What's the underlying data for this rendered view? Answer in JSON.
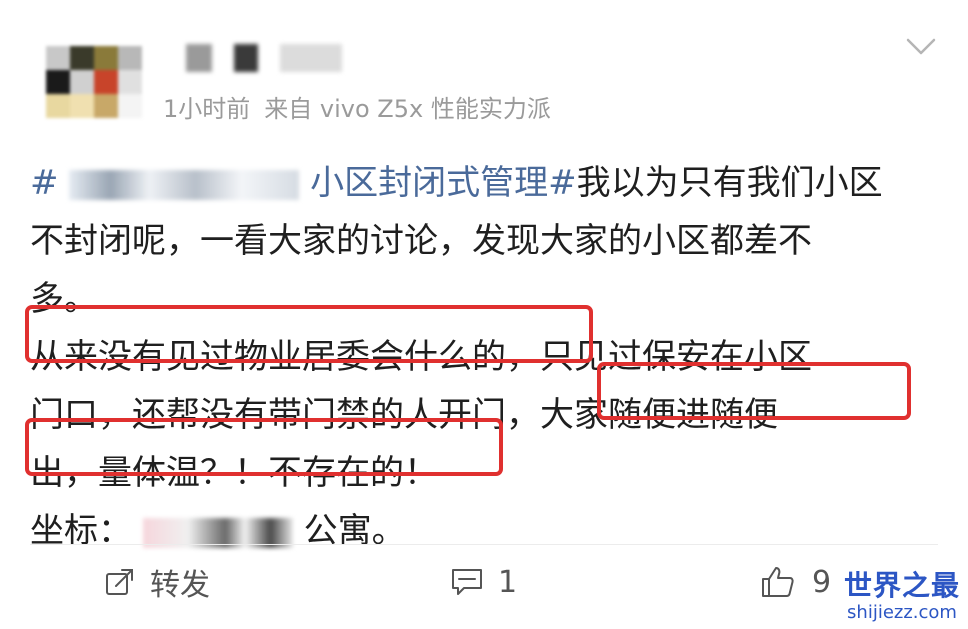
{
  "post": {
    "meta": {
      "time": "1小时前",
      "source": "来自 vivo Z5x 性能实力派"
    },
    "body": {
      "topic_hash_start": "#",
      "topic_text": "小区封闭式管理#",
      "line1_rest": "我以为只有我们小区",
      "line2": "不封闭呢，一看大家的讨论，发现大家的小区都差不",
      "line3": "多。",
      "line4_highlight": "从来没有见过物业居委会什么的，",
      "line4_rest": "只见过保安在小区",
      "line5_start": "门口，还帮没有带门禁的人开门，",
      "line5_highlight": "大家随便进随便",
      "line6_highlight": "出，量体温？！不存在的！",
      "line7_start": "坐标：",
      "line7_end": "公寓。"
    },
    "actions": {
      "repost_label": "转发",
      "comment_count": "1",
      "like_count": "9"
    }
  },
  "watermark": {
    "title": "世界之最",
    "url": "shijiezz.com"
  },
  "colors": {
    "highlight_border": "#e0302f",
    "topic": "#4a6a9a",
    "meta_text": "#9a9a9a",
    "watermark": "#2c56c4"
  },
  "icons": [
    "expand-chevron-icon",
    "repost-icon",
    "comment-icon",
    "like-icon"
  ]
}
